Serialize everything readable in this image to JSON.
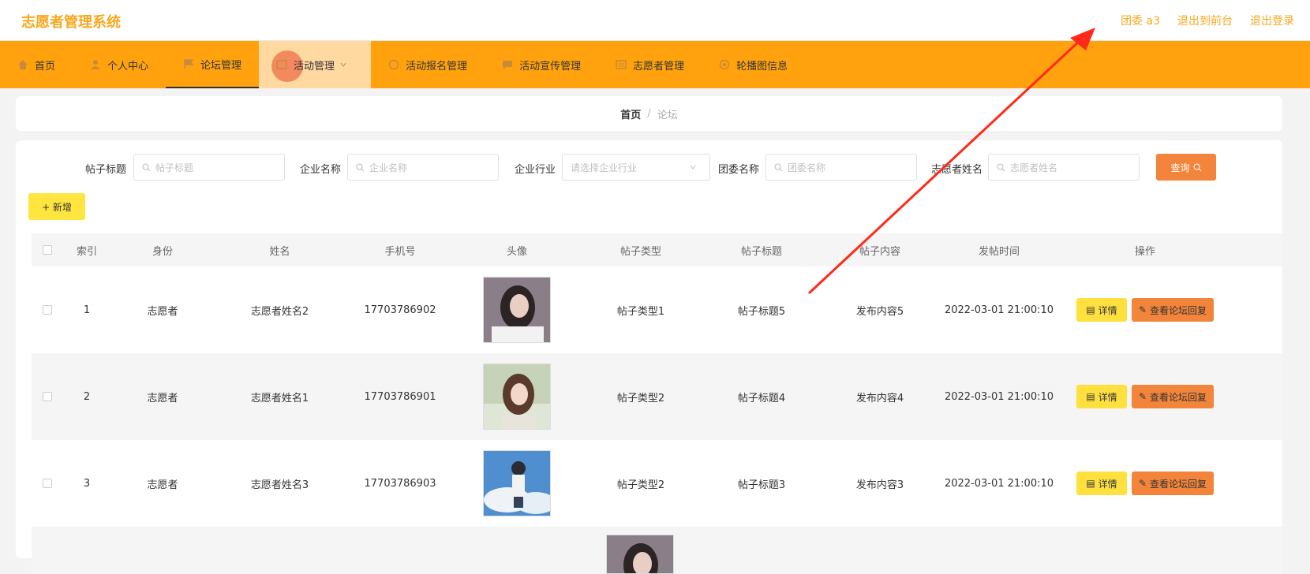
{
  "app": {
    "title": "志愿者管理系统",
    "user_label": "团委 a3",
    "front_link": "退出到前台",
    "logout_link": "退出登录"
  },
  "nav": [
    {
      "label": "首页",
      "icon": "home-icon"
    },
    {
      "label": "个人中心",
      "icon": "user-icon"
    },
    {
      "label": "论坛管理",
      "icon": "flag-icon"
    },
    {
      "label": "活动管理",
      "icon": "activity-icon"
    },
    {
      "label": "活动报名管理",
      "icon": "signup-icon"
    },
    {
      "label": "活动宣传管理",
      "icon": "chat-icon"
    },
    {
      "label": "志愿者管理",
      "icon": "list-icon"
    },
    {
      "label": "轮播图信息",
      "icon": "image-icon"
    }
  ],
  "breadcrumb": {
    "home": "首页",
    "sep": "/",
    "current": "论坛"
  },
  "search": {
    "title_label": "帖子标题",
    "title_placeholder": "帖子标题",
    "company_label": "企业名称",
    "company_placeholder": "企业名称",
    "industry_label": "企业行业",
    "industry_placeholder": "请选择企业行业",
    "league_label": "团委名称",
    "league_placeholder": "团委名称",
    "volunteer_label": "志愿者姓名",
    "volunteer_placeholder": "志愿者姓名",
    "query_label": "查询"
  },
  "actions": {
    "add_label": "+ 新增",
    "detail_label": "详情",
    "reply_label": "查看论坛回复"
  },
  "table": {
    "headers": [
      "索引",
      "身份",
      "姓名",
      "手机号",
      "头像",
      "帖子类型",
      "帖子标题",
      "帖子内容",
      "发帖时间",
      "操作"
    ],
    "rows": [
      {
        "index": "1",
        "role": "志愿者",
        "name": "志愿者姓名2",
        "phone": "17703786902",
        "type": "帖子类型1",
        "title": "帖子标题5",
        "content": "发布内容5",
        "time": "2022-03-01 21:00:10"
      },
      {
        "index": "2",
        "role": "志愿者",
        "name": "志愿者姓名1",
        "phone": "17703786901",
        "type": "帖子类型2",
        "title": "帖子标题4",
        "content": "发布内容4",
        "time": "2022-03-01 21:00:10"
      },
      {
        "index": "3",
        "role": "志愿者",
        "name": "志愿者姓名3",
        "phone": "17703786903",
        "type": "帖子类型2",
        "title": "帖子标题3",
        "content": "发布内容3",
        "time": "2022-03-01 21:00:10"
      }
    ]
  },
  "colors": {
    "accent": "#ffa20e",
    "brand_text": "#f7a81e",
    "query": "#f2853b",
    "add": "#ffe53f",
    "annotation": "#ff2a1a"
  }
}
